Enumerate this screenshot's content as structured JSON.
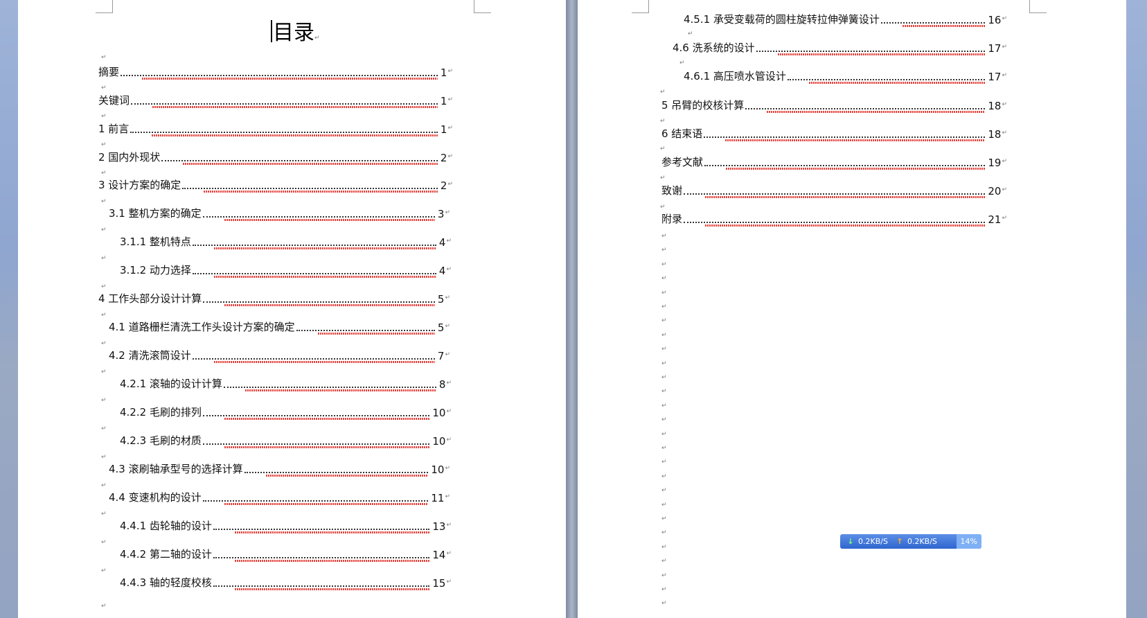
{
  "document": {
    "title": "目录",
    "paragraph_mark": "↵"
  },
  "page1": {
    "entries": [
      {
        "text": "摘要",
        "page": "1"
      },
      {
        "text": "关键词",
        "page": "1"
      },
      {
        "text": "1 前言",
        "page": "1"
      },
      {
        "text": "2 国内外现状",
        "page": "2"
      },
      {
        "text": "3 设计方案的确定",
        "page": "2"
      },
      {
        "text": "3.1 整机方案的确定",
        "page": "3"
      },
      {
        "text": "3.1.1 整机特点",
        "page": "4"
      },
      {
        "text": "3.1.2 动力选择",
        "page": "4"
      },
      {
        "text": "4 工作头部分设计计算",
        "page": "5"
      },
      {
        "text": "4.1 道路栅栏清洗工作头设计方案的确定",
        "page": "5"
      },
      {
        "text": "4.2 清洗滚筒设计",
        "page": "7"
      },
      {
        "text": "4.2.1 滚轴的设计计算",
        "page": "8"
      },
      {
        "text": "4.2.2 毛刷的排列",
        "page": "10"
      },
      {
        "text": "4.2.3 毛刷的材质",
        "page": "10"
      },
      {
        "text": "4.3 滚刷轴承型号的选择计算",
        "page": "10"
      },
      {
        "text": "4.4 变速机构的设计",
        "page": "11"
      },
      {
        "text": "4.4.1 齿轮轴的设计",
        "page": "13"
      },
      {
        "text": "4.4.2 第二轴的设计",
        "page": "14"
      },
      {
        "text": "4.4.3 轴的轻度校核",
        "page": "15"
      }
    ]
  },
  "page2": {
    "entries": [
      {
        "text": "4.5.1 承受变载荷的圆柱旋转拉伸弹簧设计",
        "page": "16"
      },
      {
        "text": "4.6 洗系统的设计",
        "page": "17"
      },
      {
        "text": "4.6.1 高压喷水管设计",
        "page": "17"
      },
      {
        "text": "5 吊臂的校核计算",
        "page": "18"
      },
      {
        "text": "6 结束语",
        "page": "18"
      },
      {
        "text": "参考文献",
        "page": "19"
      },
      {
        "text": "致谢",
        "page": "20"
      },
      {
        "text": "附录",
        "page": "21"
      }
    ]
  },
  "speed_widget": {
    "download": "0.2KB/S",
    "upload": "0.2KB/S",
    "percent": "14%",
    "download_icon": "arrow-down-icon",
    "upload_icon": "arrow-up-icon"
  },
  "colors": {
    "page": "#ffffff",
    "background": "#8a9bb4",
    "spell_underline": "#e0322b",
    "widget": "#2f66cf"
  }
}
